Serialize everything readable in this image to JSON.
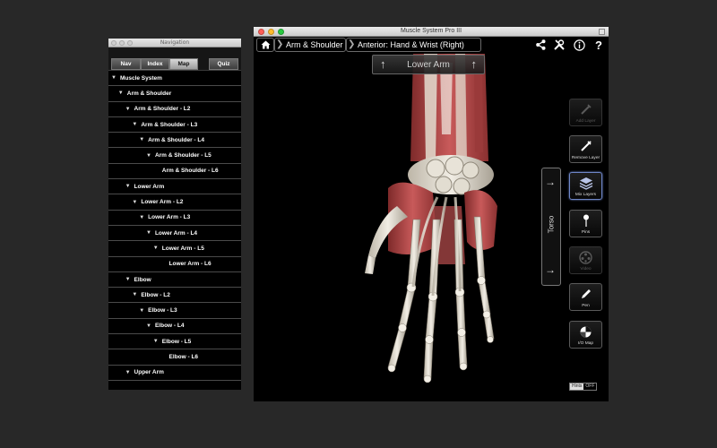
{
  "navigation": {
    "window_title": "Navigation",
    "tabs": [
      {
        "label": "Nav",
        "active": false
      },
      {
        "label": "Index",
        "active": false
      },
      {
        "label": "Map",
        "active": true
      },
      {
        "label": "Quiz",
        "active": false
      }
    ],
    "items": [
      {
        "label": "Muscle System",
        "indent": 0,
        "expandable": true
      },
      {
        "label": "Arm & Shoulder",
        "indent": 1,
        "expandable": true
      },
      {
        "label": "Arm & Shoulder - L2",
        "indent": 2,
        "expandable": true
      },
      {
        "label": "Arm & Shoulder - L3",
        "indent": 3,
        "expandable": true
      },
      {
        "label": "Arm & Shoulder - L4",
        "indent": 4,
        "expandable": true
      },
      {
        "label": "Arm & Shoulder - L5",
        "indent": 5,
        "expandable": true
      },
      {
        "label": "Arm & Shoulder - L6",
        "indent": 6,
        "expandable": false
      },
      {
        "label": "Lower Arm",
        "indent": 2,
        "expandable": true
      },
      {
        "label": "Lower Arm - L2",
        "indent": 3,
        "expandable": true
      },
      {
        "label": "Lower Arm - L3",
        "indent": 4,
        "expandable": true
      },
      {
        "label": "Lower Arm - L4",
        "indent": 5,
        "expandable": true
      },
      {
        "label": "Lower Arm - L5",
        "indent": 6,
        "expandable": true
      },
      {
        "label": "Lower Arm - L6",
        "indent": 7,
        "expandable": false
      },
      {
        "label": "Elbow",
        "indent": 2,
        "expandable": true
      },
      {
        "label": "Elbow - L2",
        "indent": 3,
        "expandable": true
      },
      {
        "label": "Elbow - L3",
        "indent": 4,
        "expandable": true
      },
      {
        "label": "Elbow - L4",
        "indent": 5,
        "expandable": true
      },
      {
        "label": "Elbow - L5",
        "indent": 6,
        "expandable": true
      },
      {
        "label": "Elbow - L6",
        "indent": 7,
        "expandable": false
      },
      {
        "label": "Upper Arm",
        "indent": 2,
        "expandable": true
      }
    ]
  },
  "main": {
    "window_title": "Muscle System Pro III",
    "breadcrumb": [
      "Arm & Shoulder",
      "Anterior: Hand & Wrist (Right)"
    ],
    "toolbar_icons": [
      "share-icon",
      "tools-icon",
      "info-icon",
      "help-icon"
    ],
    "help_glyph": "?",
    "nav_up_label": "Lower Arm",
    "torso_label": "Torso",
    "side_buttons": [
      {
        "label": "Add Layer",
        "icon": "syringe-icon",
        "state": "disabled"
      },
      {
        "label": "Remove Layer",
        "icon": "syringe-icon",
        "state": "normal"
      },
      {
        "label": "Mix Layers",
        "icon": "layers-icon",
        "state": "selected"
      },
      {
        "label": "Pins",
        "icon": "pin-icon",
        "state": "normal"
      },
      {
        "label": "Video",
        "icon": "film-reel-icon",
        "state": "disabled"
      },
      {
        "label": "Pen",
        "icon": "pen-icon",
        "state": "normal"
      },
      {
        "label": "I/O Map",
        "icon": "map-pie-icon",
        "state": "normal"
      }
    ],
    "hints": [
      "Hints",
      "OFF"
    ]
  },
  "colors": {
    "desktop": "#282828",
    "close": "#ff5f57",
    "minimize": "#ffbd2e",
    "maximize": "#28c940",
    "selected_border": "#6e86c8"
  }
}
